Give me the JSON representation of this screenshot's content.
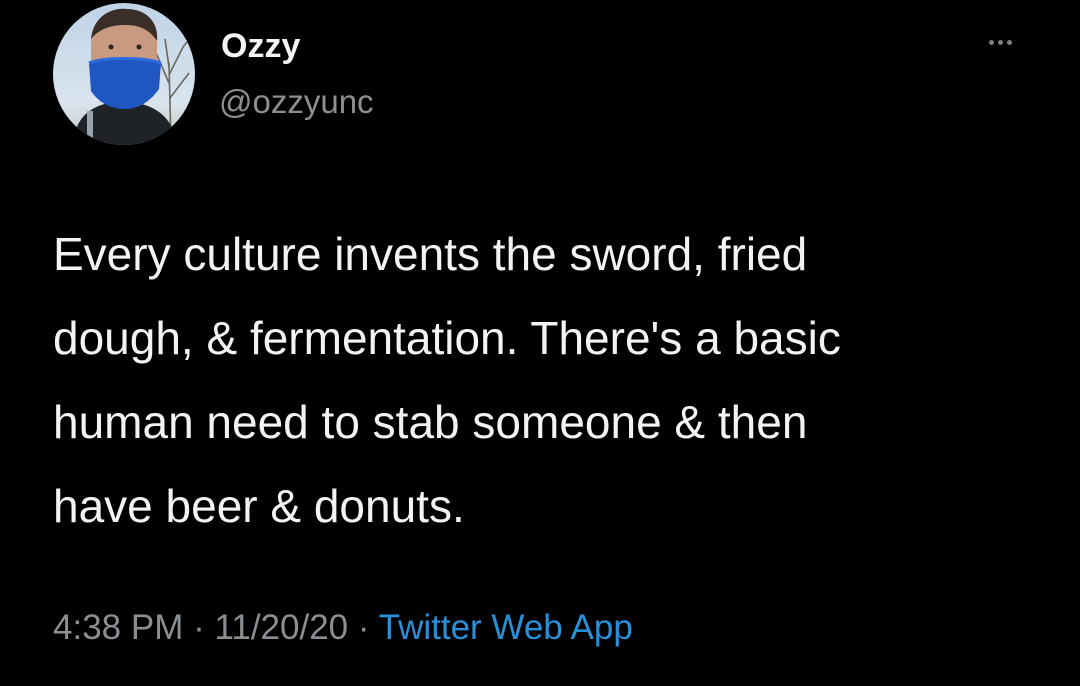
{
  "user": {
    "display_name": "Ozzy",
    "handle": "@ozzyunc"
  },
  "more_menu": {
    "icon": "more-horizontal-icon"
  },
  "tweet": {
    "lines": [
      "Every culture invents the sword, fried",
      "dough, & fermentation. There's a basic",
      "human need to stab someone & then",
      "have beer & donuts."
    ]
  },
  "meta": {
    "time": "4:38 PM",
    "separator": "·",
    "date": "11/20/20",
    "source": "Twitter Web App"
  },
  "colors": {
    "background": "#000000",
    "text": "#f3f3f3",
    "secondary": "#8b8f93",
    "link": "#2b8fd8"
  }
}
